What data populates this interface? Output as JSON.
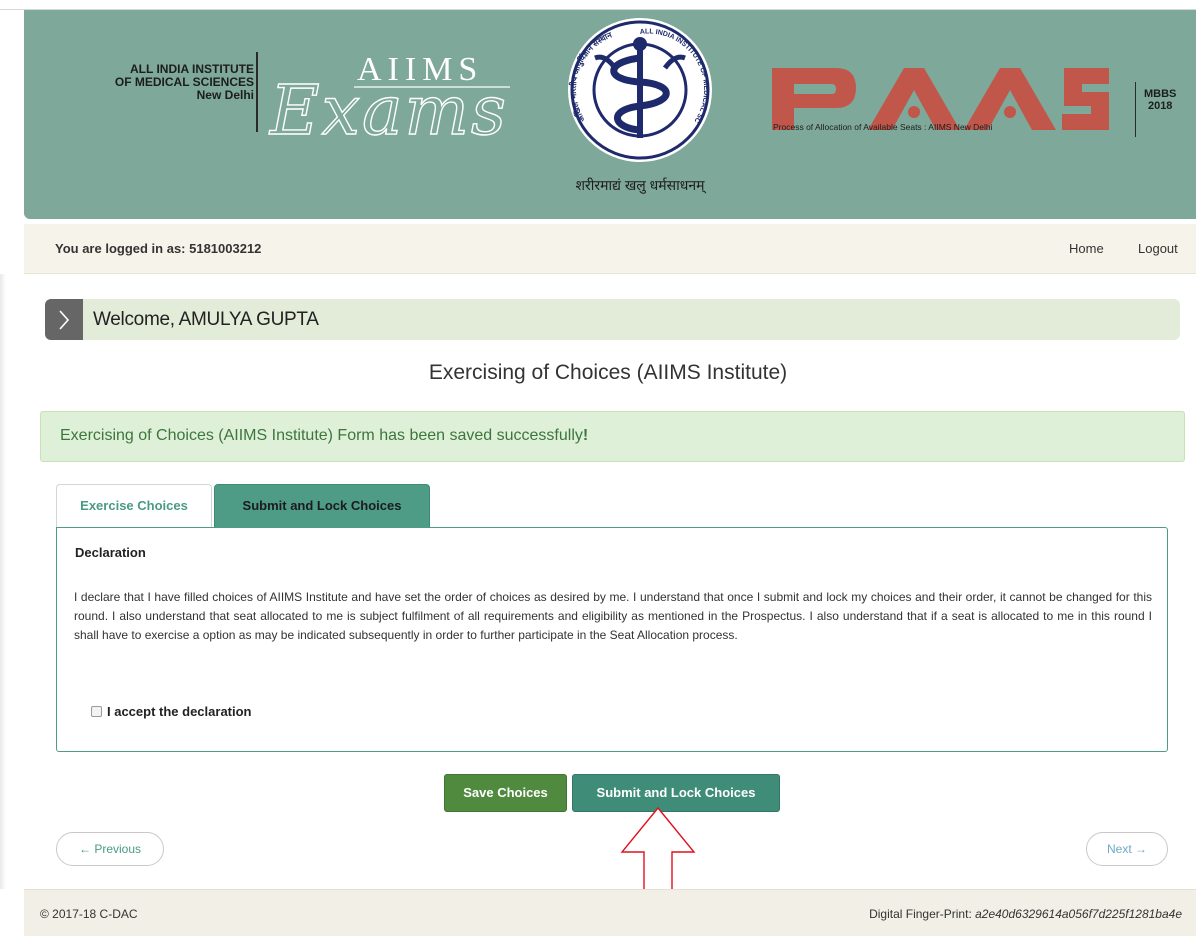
{
  "header": {
    "institute_line1": "ALL INDIA INSTITUTE",
    "institute_line2": "OF MEDICAL SCIENCES",
    "institute_line3": "New Delhi",
    "exams_brand_top": "AIIMS",
    "exams_brand_script": "Exams",
    "emblem_motto": "शरीरमाद्यं खलु धर्मसाधनम्",
    "emblem_ring_left": "अखिल भारतीय आयुर्विज्ञान संस्थान",
    "emblem_ring_right": "ALL INDIA INSTITUTE OF MEDICAL SCIENCES",
    "paas_title": "PAAS",
    "paas_tagline": "Process of Allocation of Available Seats : AIIMS New Delhi",
    "course": "MBBS",
    "year": "2018",
    "colors": {
      "banner": "#7ea899",
      "paas_red": "#c0574a"
    }
  },
  "login_bar": {
    "logged_in_text": "You are logged in as: 5181003212",
    "nav": {
      "home": "Home",
      "logout": "Logout"
    }
  },
  "welcome": {
    "text": "Welcome, AMULYA GUPTA",
    "icon": "chevron-right-icon"
  },
  "page_title": "Exercising of Choices (AIIMS Institute)",
  "alert": {
    "message": "Exercising of Choices (AIIMS Institute) Form has been saved successfully",
    "suffix": "!",
    "color": "#3c763d"
  },
  "tabs": [
    {
      "label": "Exercise Choices",
      "active": false
    },
    {
      "label": "Submit and Lock Choices",
      "active": true
    }
  ],
  "declaration": {
    "heading": "Declaration",
    "text": "I declare that I have filled choices of AIIMS Institute and have set the order of choices as desired by me. I understand that once I submit and lock my choices and their order, it cannot be changed for this round. I also understand that seat allocated to me is subject fulfilment of all requirements and eligibility as mentioned in the Prospectus. I also understand that if a seat is allocated to me in this round I shall have to exercise a option as may be indicated subsequently in order to further participate in the Seat Allocation process.",
    "accept_label": "I accept the declaration",
    "accepted": false
  },
  "actions": {
    "save_label": "Save Choices",
    "submit_lock_label": "Submit and Lock Choices"
  },
  "pager": {
    "previous_label": "← Previous",
    "next_label": "Next →"
  },
  "footer": {
    "copyright": "© 2017-18 C-DAC",
    "fingerprint_label": "Digital Finger-Print: ",
    "fingerprint_hash": "a2e40d6329614a056f7d225f1281ba4e"
  }
}
